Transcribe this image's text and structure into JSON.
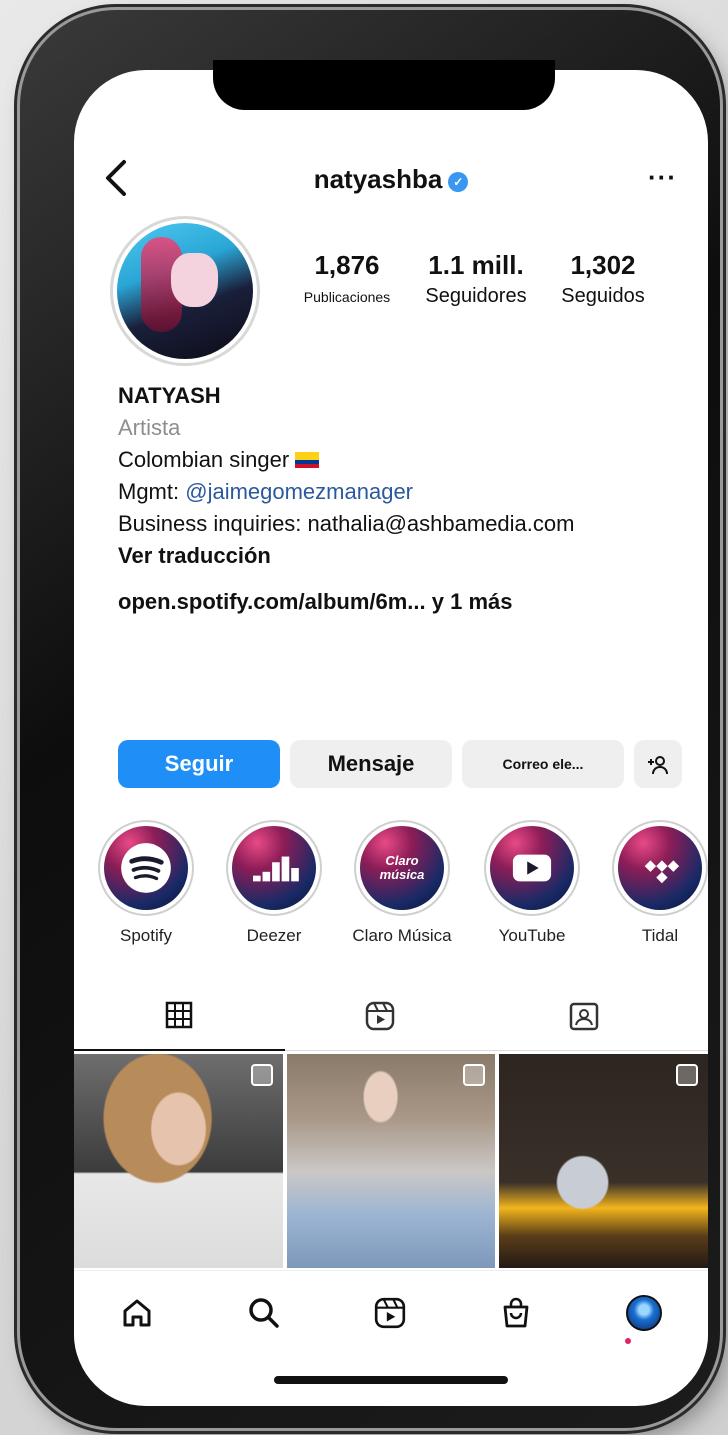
{
  "header": {
    "username": "natyashba",
    "verified_icon": "verified-badge-icon",
    "more_label": "···"
  },
  "stats": [
    {
      "value": "1,876",
      "label": "Publicaciones"
    },
    {
      "value": "1.1 mill.",
      "label": "Seguidores"
    },
    {
      "value": "1,302",
      "label": "Seguidos"
    }
  ],
  "bio": {
    "name": "NATYASH",
    "category": "Artista",
    "line1": "Colombian singer",
    "mgmt_prefix": "Mgmt: ",
    "mgmt_handle": "@jaimegomezmanager",
    "business": "Business inquiries: nathalia@ashbamedia.com",
    "translate": "Ver traducción",
    "link": "open.spotify.com/album/6m...",
    "link_more": " y 1 más"
  },
  "actions": {
    "follow": "Seguir",
    "message": "Mensaje",
    "email": "Correo ele...",
    "suggest_icon": "add-person-icon"
  },
  "highlights": [
    {
      "label": "Spotify",
      "icon": "spotify-icon"
    },
    {
      "label": "Deezer",
      "icon": "deezer-icon"
    },
    {
      "label": "Claro Música",
      "icon": "claro-musica-icon",
      "badge": "Claro música"
    },
    {
      "label": "YouTube",
      "icon": "youtube-icon"
    },
    {
      "label": "Tidal",
      "icon": "tidal-icon"
    }
  ],
  "tabs": [
    {
      "name": "posts",
      "icon": "grid-icon"
    },
    {
      "name": "reels",
      "icon": "reels-icon"
    },
    {
      "name": "tagged",
      "icon": "tagged-icon"
    }
  ],
  "bottom_nav": [
    "home-icon",
    "search-icon",
    "reels-icon",
    "shop-icon",
    "profile-avatar"
  ],
  "colors": {
    "primary": "#1f8ff7",
    "link": "#2b5a9c",
    "verified": "#3897f0"
  }
}
